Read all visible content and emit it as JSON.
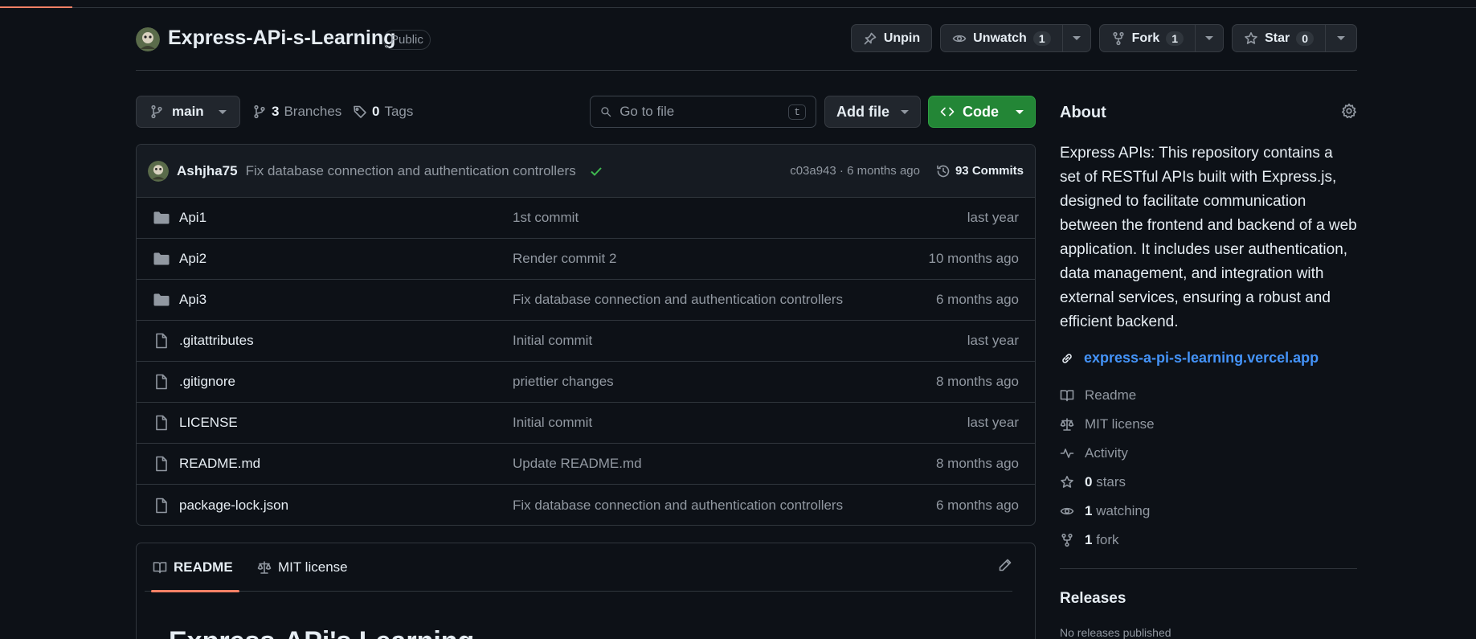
{
  "repo": {
    "name": "Express-APi-s-Learning",
    "visibility": "Public"
  },
  "actions": {
    "pin_label": "Unpin",
    "watch_label": "Unwatch",
    "watch_count": "1",
    "fork_label": "Fork",
    "fork_count": "1",
    "star_label": "Star",
    "star_count": "0"
  },
  "toolbar": {
    "branch": "main",
    "branches_count": "3",
    "branches_label": "Branches",
    "tags_count": "0",
    "tags_label": "Tags",
    "goto_placeholder": "Go to file",
    "goto_kbd": "t",
    "add_file_label": "Add file",
    "code_label": "Code"
  },
  "latest_commit": {
    "author": "Ashjha75",
    "message": "Fix database connection and authentication controllers",
    "meta": "c03a943 · 6 months ago",
    "commits_label": "93 Commits"
  },
  "files": [
    {
      "type": "folder",
      "name": "Api1",
      "message": "1st commit",
      "date": "last year"
    },
    {
      "type": "folder",
      "name": "Api2",
      "message": "Render commit 2",
      "date": "10 months ago"
    },
    {
      "type": "folder",
      "name": "Api3",
      "message": "Fix database connection and authentication controllers",
      "date": "6 months ago"
    },
    {
      "type": "file",
      "name": ".gitattributes",
      "message": "Initial commit",
      "date": "last year"
    },
    {
      "type": "file",
      "name": ".gitignore",
      "message": "priettier changes",
      "date": "8 months ago"
    },
    {
      "type": "file",
      "name": "LICENSE",
      "message": "Initial commit",
      "date": "last year"
    },
    {
      "type": "file",
      "name": "README.md",
      "message": "Update README.md",
      "date": "8 months ago"
    },
    {
      "type": "file",
      "name": "package-lock.json",
      "message": "Fix database connection and authentication controllers",
      "date": "6 months ago"
    }
  ],
  "readme": {
    "tab_readme": "README",
    "tab_license": "MIT license",
    "heading_partial": "Express-APi's Learning"
  },
  "about": {
    "title": "About",
    "description": "Express APIs: This repository contains a set of RESTful APIs built with Express.js, designed to facilitate communication between the frontend and backend of a web application. It includes user authentication, data management, and integration with external services, ensuring a robust and efficient backend.",
    "homepage": "express-a-pi-s-learning.vercel.app",
    "readme_label": "Readme",
    "license_label": "MIT license",
    "activity_label": "Activity",
    "stars_count": "0",
    "stars_label": "stars",
    "watching_count": "1",
    "watching_label": "watching",
    "forks_count": "1",
    "forks_label": "fork"
  },
  "releases": {
    "title": "Releases",
    "empty": "No releases published"
  },
  "colors": {
    "background": "#0d1117",
    "accent_link": "#4493f8",
    "code_button": "#238636",
    "tab_underline": "#f78166"
  }
}
